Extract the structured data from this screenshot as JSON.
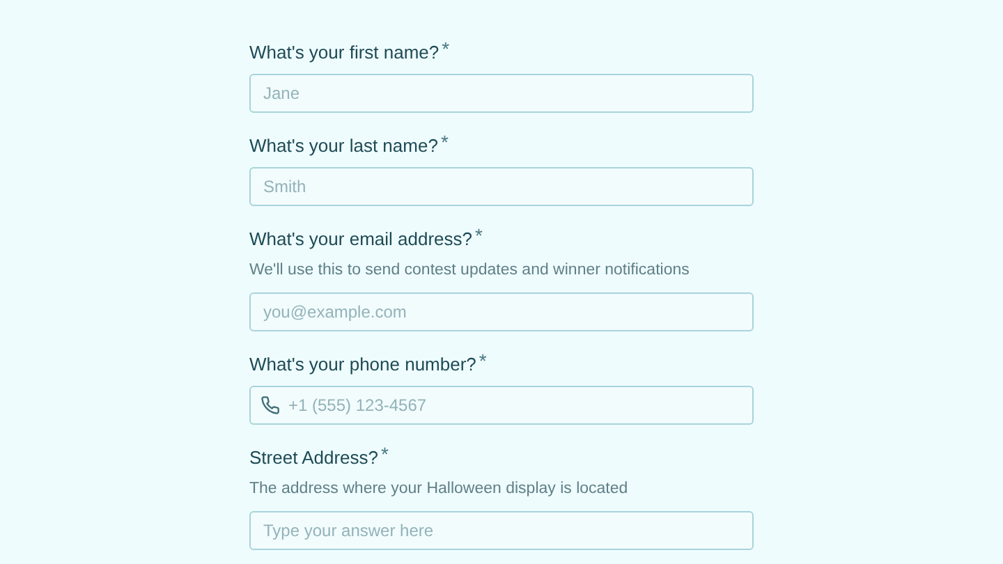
{
  "fields": [
    {
      "kind": "text",
      "label": "What's your first name?",
      "required_mark": "*",
      "placeholder": "Jane"
    },
    {
      "kind": "text",
      "label": "What's your last name?",
      "required_mark": "*",
      "placeholder": "Smith"
    },
    {
      "kind": "text",
      "label": "What's your email address?",
      "required_mark": "*",
      "help": "We'll use this to send contest updates and winner notifications",
      "placeholder": "you@example.com"
    },
    {
      "kind": "phone",
      "label": "What's your phone number?",
      "required_mark": "*",
      "placeholder": "+1 (555) 123-4567"
    },
    {
      "kind": "text",
      "label": "Street Address?",
      "required_mark": "*",
      "help": "The address where your Halloween display is located",
      "placeholder": "Type your answer here"
    }
  ]
}
